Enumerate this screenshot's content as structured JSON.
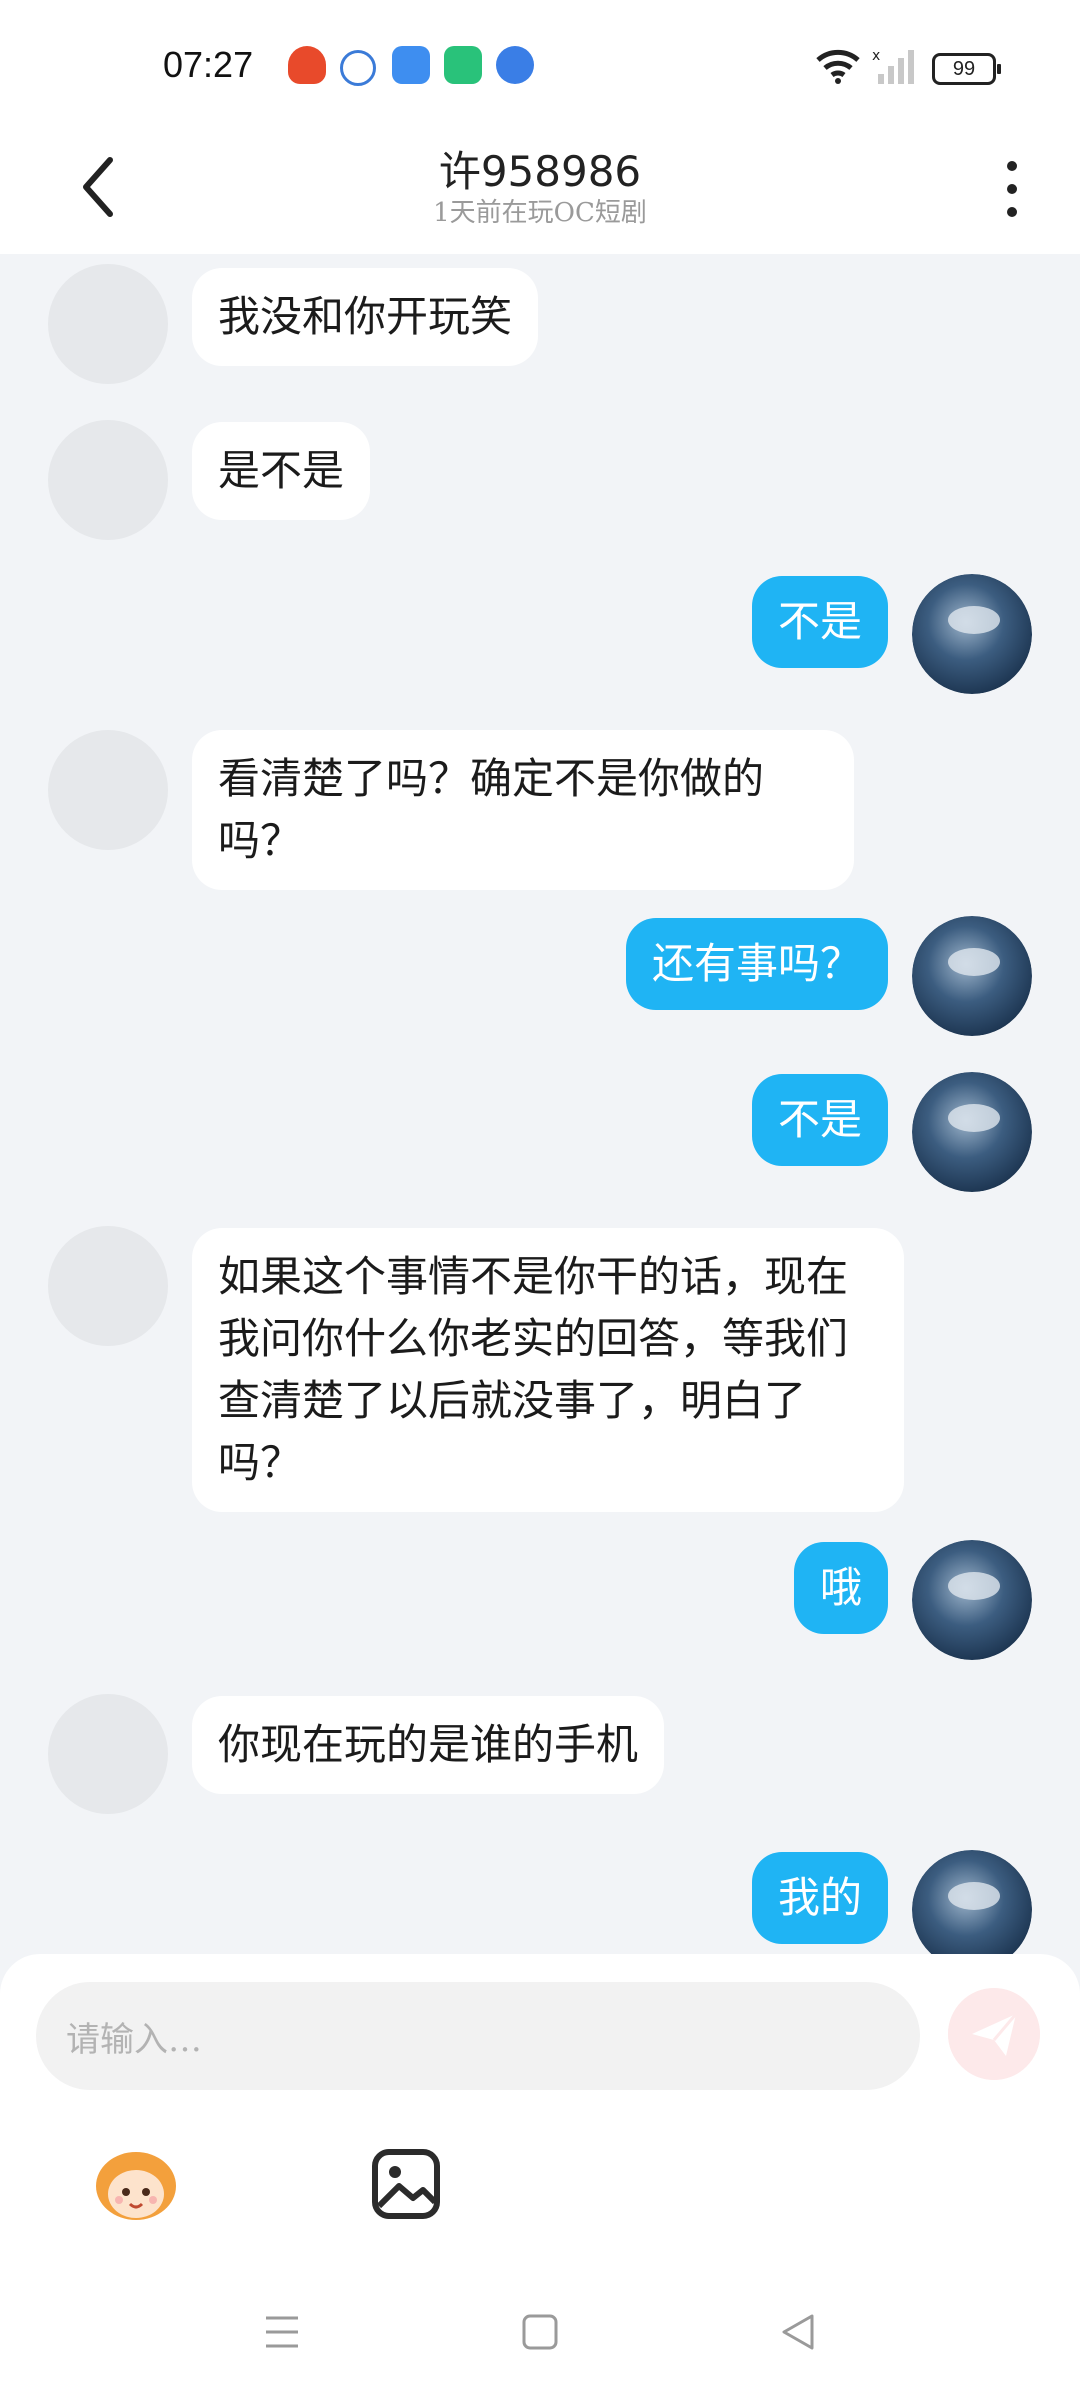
{
  "status_bar": {
    "time": "07:27",
    "battery": "99",
    "app_icons": [
      "alarm-app-icon",
      "ifly-app-icon",
      "weather-app-icon",
      "battery-app-icon",
      "browser-app-icon"
    ],
    "signal_icons": [
      "wifi-icon",
      "cellular-signal-icon"
    ]
  },
  "header": {
    "title": "许958986",
    "subtitle": "1天前在玩OC短剧"
  },
  "messages": [
    {
      "side": "in",
      "text": "我没和你开玩笑"
    },
    {
      "side": "in",
      "text": "是不是"
    },
    {
      "side": "out",
      "text": "不是"
    },
    {
      "side": "in",
      "text": "看清楚了吗？确定不是你做的吗？"
    },
    {
      "side": "out",
      "text": "还有事吗？"
    },
    {
      "side": "out",
      "text": "不是"
    },
    {
      "side": "in",
      "text": "如果这个事情不是你干的话，现在我问你什么你老实的回答，等我们查清楚了以后就没事了，明白了吗？"
    },
    {
      "side": "out",
      "text": "哦"
    },
    {
      "side": "in",
      "text": "你现在玩的是谁的手机"
    },
    {
      "side": "out",
      "text": "我的"
    }
  ],
  "composer": {
    "placeholder": "请输入…"
  },
  "colors": {
    "accent": "#1fb4f4",
    "background": "#f2f4f7",
    "send_button": "#fde9ea"
  }
}
